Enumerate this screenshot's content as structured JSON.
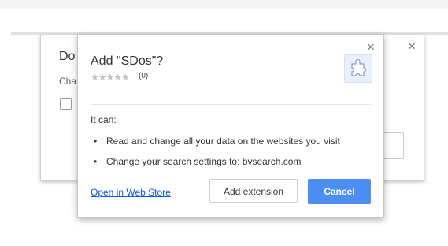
{
  "background_dialog": {
    "title": "Do",
    "subtitle": "Cha",
    "close_glyph": "×"
  },
  "popup": {
    "title": "Add \"SDos\"?",
    "rating_stars": "★★★★★",
    "rating_count": "(0)",
    "close_glyph": "×",
    "icon": "puzzle-icon",
    "permissions_heading": "It can:",
    "bullet_glyph": "•",
    "permissions": [
      "Read and change all your data on the websites you visit",
      "Change your search settings to: bvsearch.com"
    ],
    "web_store_link": "Open in Web Store",
    "add_button": "Add extension",
    "cancel_button": "Cancel"
  },
  "colors": {
    "accent": "#4c8ef2",
    "link": "#1558d6"
  }
}
